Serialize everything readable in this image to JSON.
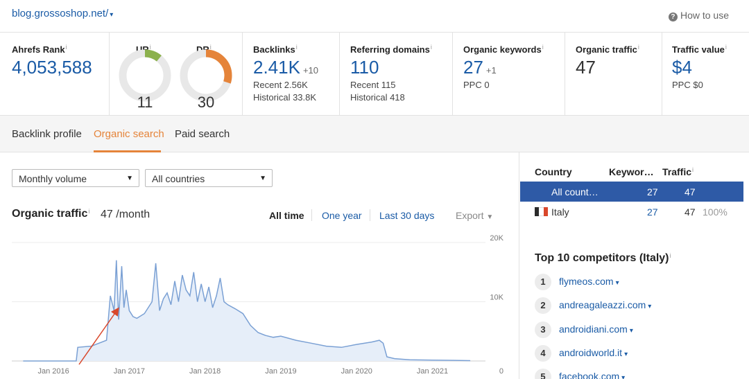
{
  "header": {
    "domain": "blog.grossoshop.net/",
    "domain_caret": "▾",
    "how_to": "How to use",
    "help_icon": "?"
  },
  "metrics": {
    "ahrefs_rank": {
      "label": "Ahrefs Rank",
      "value": "4,053,588"
    },
    "ur": {
      "label": "UR",
      "value": "11",
      "fraction": 0.11,
      "color": "#8cb14d"
    },
    "dr": {
      "label": "DR",
      "value": "30",
      "fraction": 0.3,
      "color": "#e5843a"
    },
    "backlinks": {
      "label": "Backlinks",
      "value": "2.41K",
      "delta": "+10",
      "recent": "Recent 2.56K",
      "historical": "Historical 33.8K"
    },
    "referring_domains": {
      "label": "Referring domains",
      "value": "110",
      "recent": "Recent 115",
      "historical": "Historical 418"
    },
    "organic_keywords": {
      "label": "Organic keywords",
      "value": "27",
      "delta": "+1",
      "ppc": "PPC 0"
    },
    "organic_traffic": {
      "label": "Organic traffic",
      "value": "47"
    },
    "traffic_value": {
      "label": "Traffic value",
      "value": "$4",
      "ppc": "PPC $0"
    }
  },
  "info_mark": "i",
  "tabs": [
    {
      "label": "Backlink profile",
      "active": false
    },
    {
      "label": "Organic search",
      "active": true
    },
    {
      "label": "Paid search",
      "active": false
    }
  ],
  "filters": {
    "volume": "Monthly volume",
    "countries": "All countries",
    "caret": "▼"
  },
  "organic_traffic": {
    "title": "Organic traffic",
    "value": "47 /month",
    "ranges": [
      "All time",
      "One year",
      "Last 30 days"
    ],
    "selected_range": "All time",
    "export": "Export",
    "export_caret": "▼"
  },
  "chart_data": {
    "type": "area",
    "title": "Organic traffic",
    "x_tick_labels": [
      "Jan 2016",
      "Jan 2017",
      "Jan 2018",
      "Jan 2019",
      "Jan 2020",
      "Jan 2021"
    ],
    "y_tick_labels": [
      "20K",
      "10K",
      "0"
    ],
    "ylim": [
      0,
      20000
    ],
    "x": [
      2015.6,
      2016.3,
      2016.32,
      2016.5,
      2016.7,
      2016.75,
      2016.8,
      2016.83,
      2016.86,
      2016.9,
      2016.93,
      2016.96,
      2017.0,
      2017.05,
      2017.1,
      2017.2,
      2017.3,
      2017.35,
      2017.4,
      2017.45,
      2017.5,
      2017.55,
      2017.6,
      2017.65,
      2017.7,
      2017.75,
      2017.8,
      2017.85,
      2017.9,
      2017.95,
      2018.0,
      2018.05,
      2018.1,
      2018.15,
      2018.2,
      2018.25,
      2018.3,
      2018.4,
      2018.5,
      2018.6,
      2018.7,
      2018.8,
      2018.9,
      2019.0,
      2019.2,
      2019.4,
      2019.6,
      2019.8,
      2020.0,
      2020.2,
      2020.3,
      2020.35,
      2020.4,
      2020.5,
      2020.7,
      2021.0,
      2021.3,
      2021.5
    ],
    "y": [
      0,
      0,
      2300,
      2500,
      3500,
      11000,
      8500,
      17000,
      7000,
      16000,
      9000,
      12000,
      8500,
      7500,
      7200,
      8000,
      10000,
      16500,
      8500,
      10500,
      11500,
      9500,
      13500,
      10000,
      14500,
      12000,
      11000,
      15000,
      10000,
      13000,
      10000,
      12500,
      9000,
      11000,
      14000,
      10000,
      9500,
      8800,
      8000,
      6000,
      4800,
      4300,
      4000,
      4200,
      3500,
      3000,
      2500,
      2300,
      2800,
      3200,
      3500,
      3000,
      700,
      400,
      200,
      150,
      100,
      60
    ],
    "annotation": "red arrow pointing at traffic rise",
    "grid": true,
    "line_color": "#7aa0d4",
    "fill_color": "#e6eef9"
  },
  "country_table": {
    "headers": [
      "Country",
      "Keywor…",
      "Traffic"
    ],
    "rows": [
      {
        "country": "All count…",
        "keywords": "27",
        "traffic": "47",
        "share": "",
        "selected": true
      },
      {
        "country": "Italy",
        "keywords": "27",
        "traffic": "47",
        "share": "100%",
        "selected": false
      }
    ]
  },
  "competitors": {
    "title": "Top 10 competitors (Italy)",
    "caret": "▾",
    "items": [
      {
        "rank": "1",
        "domain": "flymeos.com"
      },
      {
        "rank": "2",
        "domain": "andreagaleazzi.com"
      },
      {
        "rank": "3",
        "domain": "androidiani.com"
      },
      {
        "rank": "4",
        "domain": "androidworld.it"
      },
      {
        "rank": "5",
        "domain": "facebook.com"
      }
    ]
  }
}
